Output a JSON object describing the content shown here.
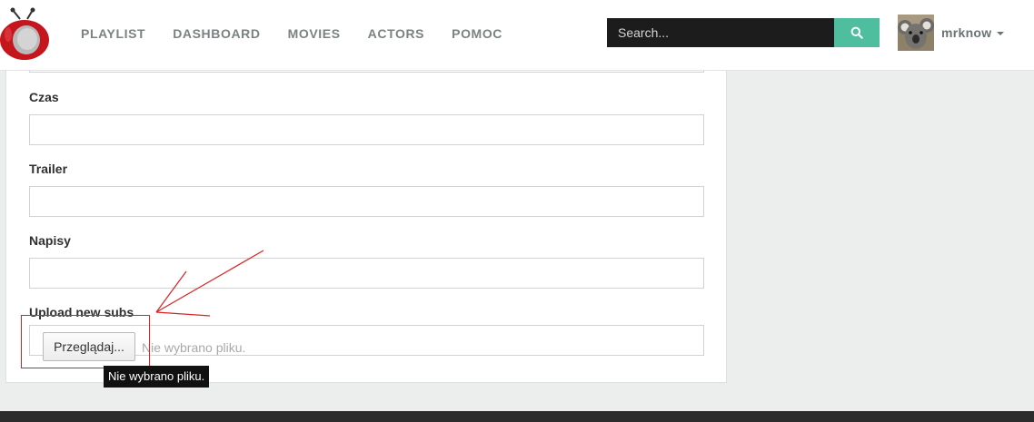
{
  "brand": {
    "logo_icon": "tv-logo-icon"
  },
  "nav": {
    "items": [
      {
        "label": "PLAYLIST"
      },
      {
        "label": "DASHBOARD"
      },
      {
        "label": "MOVIES"
      },
      {
        "label": "ACTORS"
      },
      {
        "label": "POMOC"
      }
    ]
  },
  "search": {
    "placeholder": "Search...",
    "icon": "search-icon"
  },
  "user": {
    "name": "mrknow",
    "avatar": "koala-avatar"
  },
  "form": {
    "fields": [
      {
        "label": "Czas",
        "value": ""
      },
      {
        "label": "Trailer",
        "value": ""
      },
      {
        "label": "Napisy",
        "value": ""
      }
    ],
    "upload": {
      "label": "Upload new subs",
      "button_label": "Przeglądaj...",
      "status": "Nie wybrano pliku."
    }
  },
  "tooltip": {
    "text": "Nie wybrano pliku."
  },
  "colors": {
    "accent": "#4fbe9f",
    "annotation": "#d82323",
    "nav_text": "#7a8282",
    "search_bg": "#1c1c1c"
  }
}
